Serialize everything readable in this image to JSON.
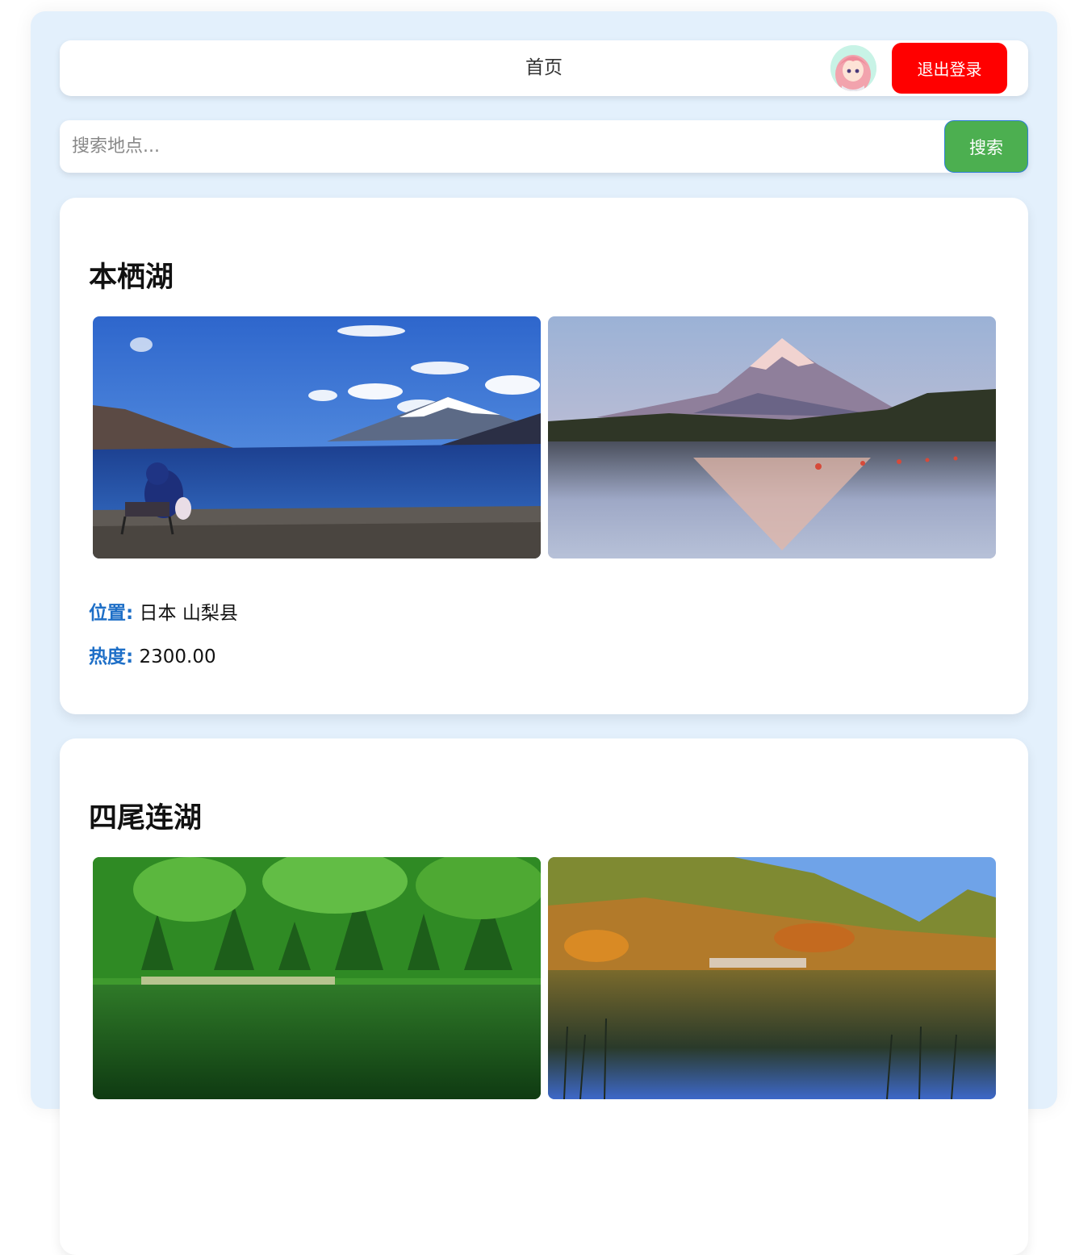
{
  "navbar": {
    "title": "首页",
    "logout_label": "退出登录"
  },
  "search": {
    "placeholder": "搜索地点...",
    "button_label": "搜索"
  },
  "places": [
    {
      "name": "本栖湖",
      "location_label": "位置:",
      "location": "日本 山梨县",
      "popularity_label": "热度:",
      "popularity": "2300.00"
    },
    {
      "name": "四尾连湖"
    }
  ],
  "colors": {
    "page_bg": "#e3f0fc",
    "logout": "#ff0000",
    "search_button": "#4caf50",
    "label_accent": "#1e6fc7"
  }
}
